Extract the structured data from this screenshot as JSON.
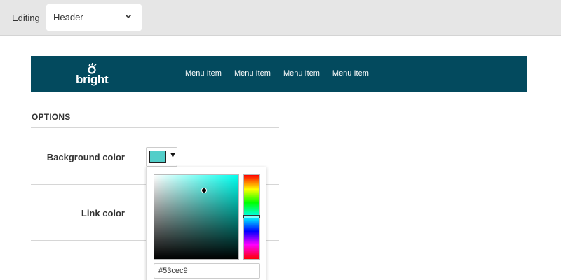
{
  "topbar": {
    "editing_label": "Editing",
    "section_select": {
      "value": "Header",
      "icon": "chevron-down-icon"
    }
  },
  "preview": {
    "background_color": "#034a5e",
    "logo": {
      "text": "bright",
      "mark_icon": "logo-flame-icon"
    },
    "menu_items": [
      "Menu Item",
      "Menu Item",
      "Menu Item",
      "Menu Item"
    ]
  },
  "options": {
    "title": "OPTIONS",
    "rows": [
      {
        "label": "Background color"
      },
      {
        "label": "Link color"
      }
    ],
    "color_button": {
      "swatch_color": "#53cec9",
      "caret": "▼"
    },
    "color_picker": {
      "hue_color": "#00ffee",
      "hex_value": "#53cec9"
    }
  }
}
